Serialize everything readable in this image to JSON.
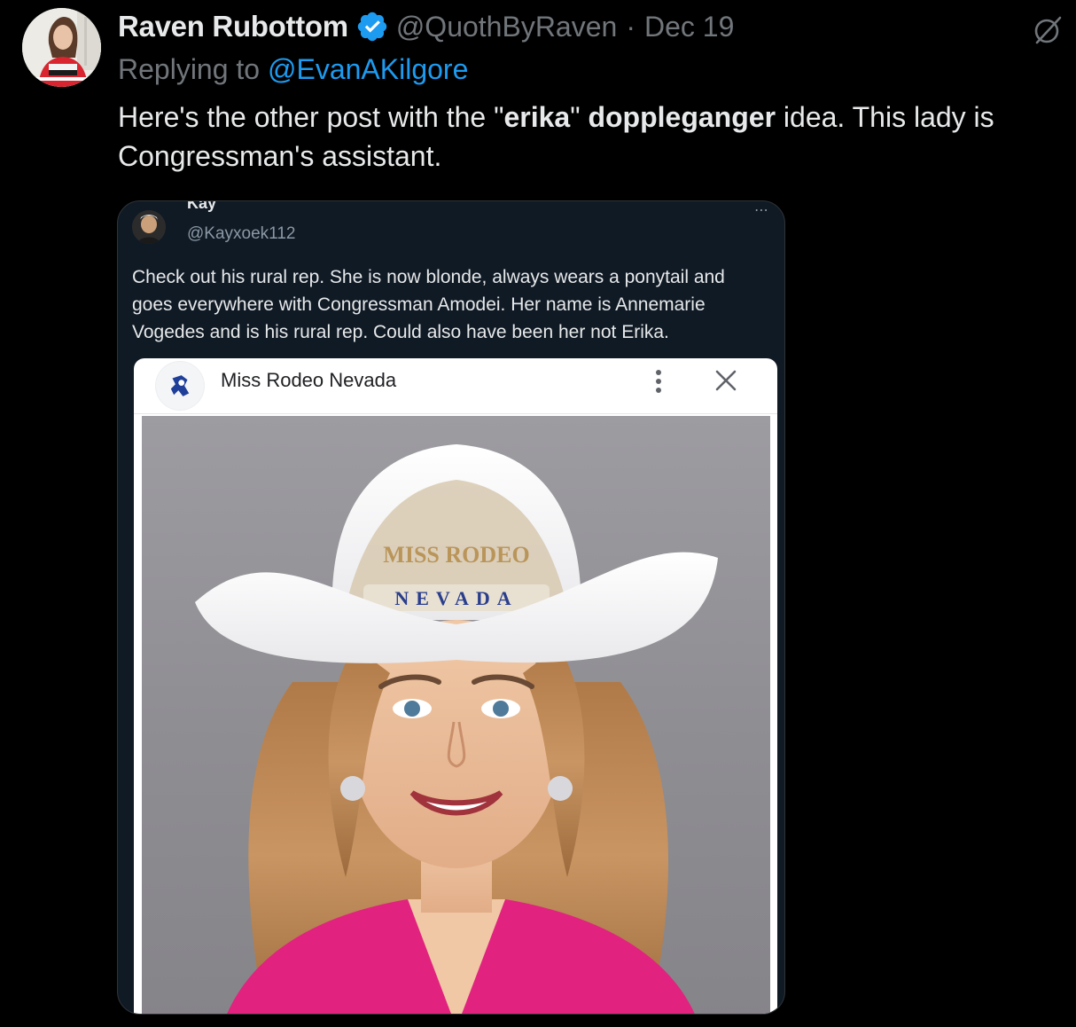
{
  "tweet": {
    "display_name": "Raven Rubottom",
    "handle": "@QuothByRaven",
    "separator": "·",
    "date": "Dec 19",
    "replying_prefix": "Replying to ",
    "replying_to": "@EvanAKilgore",
    "text_segments": {
      "s1": "Here's the other post with the \"",
      "s2": "erika",
      "s3": "\" ",
      "s4": "doppleganger",
      "s5": " idea.   This lady is Congressman's assistant."
    }
  },
  "embedded_post": {
    "name": "Kay",
    "handle": "@Kayxoek112",
    "icons": "⋯",
    "text": "Check out his rural rep. She is now blonde, always wears a ponytail and goes everywhere with Congressman Amodei. Her name is Annemarie Vogedes and is his rural rep. Could also have been her not Erika."
  },
  "phone_screenshot": {
    "site_title": "Miss Rodeo Nevada",
    "hat_banner_text": "NEVADA",
    "crown_text": "MISS RODEO"
  },
  "colors": {
    "background": "#000000",
    "link": "#1d9bf0",
    "secondary": "#71767b",
    "verified": "#1d9bf0"
  }
}
